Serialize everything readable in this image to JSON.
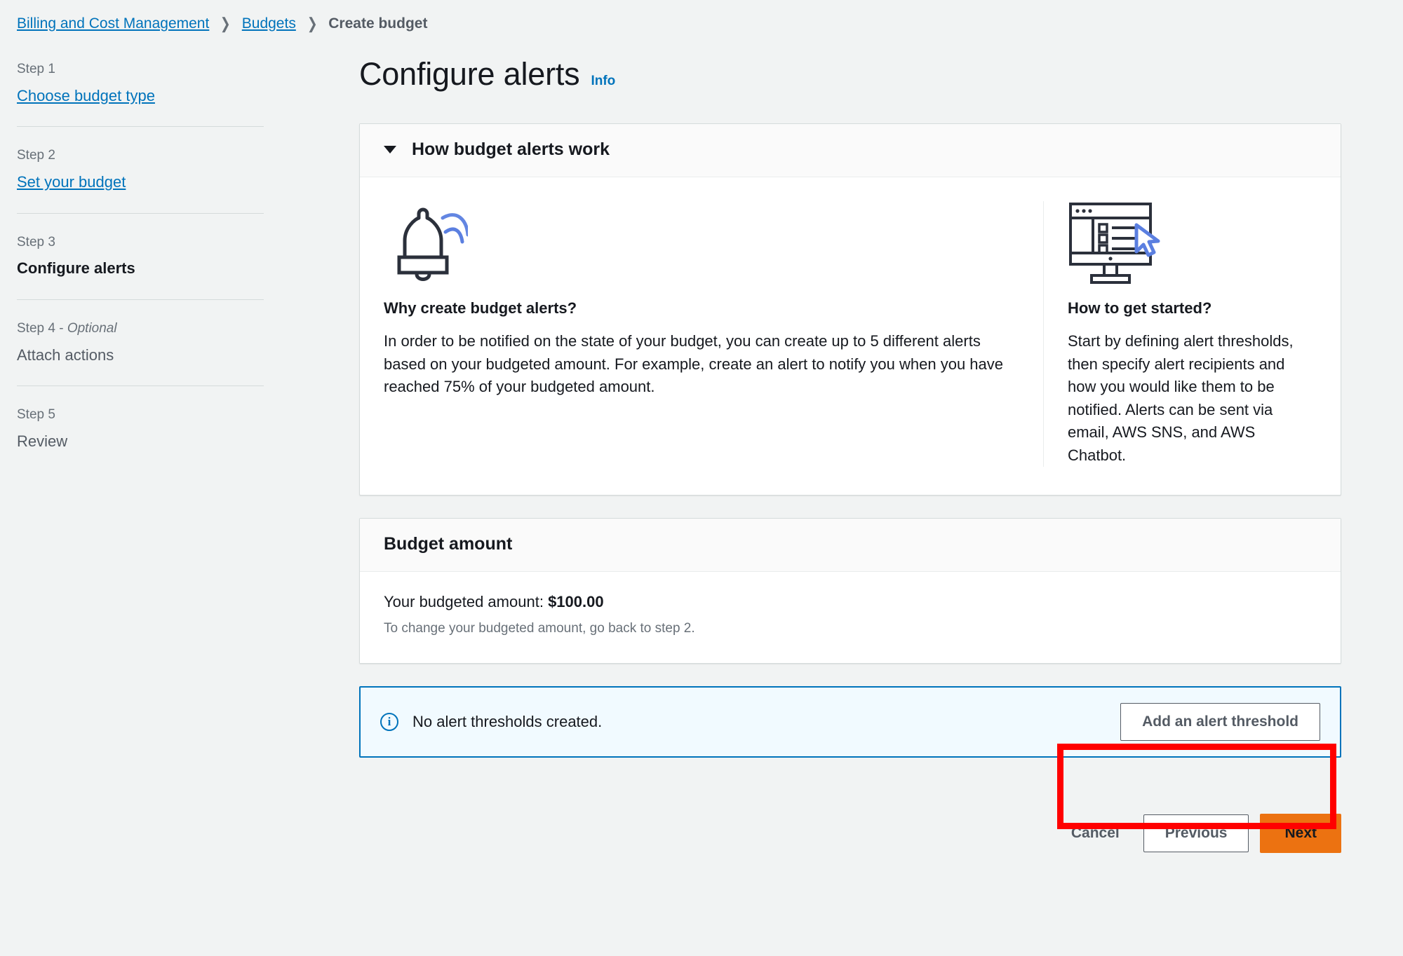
{
  "breadcrumb": {
    "items": [
      {
        "label": "Billing and Cost Management",
        "type": "link"
      },
      {
        "label": "Budgets",
        "type": "link"
      },
      {
        "label": "Create budget",
        "type": "current"
      }
    ],
    "separator": "❯"
  },
  "sidebar": {
    "steps": [
      {
        "step_label": "Step 1",
        "optional": "",
        "name": "Choose budget type",
        "state": "link"
      },
      {
        "step_label": "Step 2",
        "optional": "",
        "name": "Set your budget",
        "state": "link"
      },
      {
        "step_label": "Step 3",
        "optional": "",
        "name": "Configure alerts",
        "state": "active"
      },
      {
        "step_label": "Step 4 - ",
        "optional": "Optional",
        "name": "Attach actions",
        "state": "plain"
      },
      {
        "step_label": "Step 5",
        "optional": "",
        "name": "Review",
        "state": "plain"
      }
    ]
  },
  "page": {
    "title": "Configure alerts",
    "info_label": "Info"
  },
  "how_it_works": {
    "heading": "How budget alerts work",
    "left": {
      "icon": "bell-alert-icon",
      "title": "Why create budget alerts?",
      "text": "In order to be notified on the state of your budget, you can create up to 5 different alerts based on your budgeted amount. For example, create an alert to notify you when you have reached 75% of your budgeted amount."
    },
    "right": {
      "icon": "monitor-checklist-icon",
      "title": "How to get started?",
      "text": "Start by defining alert thresholds, then specify alert recipients and how you would like them to be notified. Alerts can be sent via email, AWS SNS, and AWS Chatbot."
    }
  },
  "budget_amount": {
    "heading": "Budget amount",
    "amount_label": "Your budgeted amount:",
    "amount_value": "$100.00",
    "sub_text": "To change your budgeted amount, go back to step 2."
  },
  "alert_banner": {
    "icon": "info-circle-icon",
    "message": "No alert thresholds created.",
    "action_label": "Add an alert threshold",
    "highlighted": true
  },
  "footer": {
    "cancel_label": "Cancel",
    "previous_label": "Previous",
    "next_label": "Next"
  },
  "colors": {
    "page_background": "#f1f3f3",
    "link": "#0073bb",
    "primary_button": "#ec7211",
    "banner_background": "#f1faff",
    "banner_border": "#0073bb",
    "highlight_annotation": "#ff0000",
    "text": "#16191f",
    "muted_text": "#687078"
  }
}
